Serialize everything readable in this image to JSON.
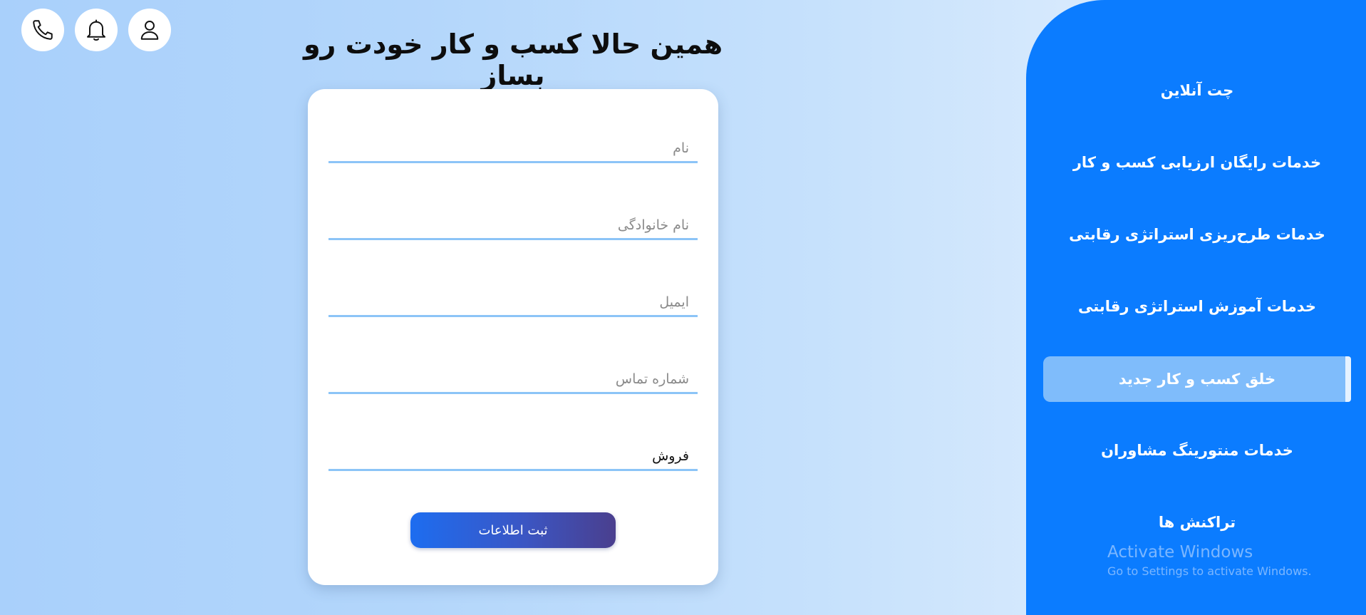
{
  "header": {
    "title": "همین حالا کسب و کار خودت رو بساز",
    "icons": [
      "phone-icon",
      "bell-icon",
      "user-icon"
    ]
  },
  "form": {
    "fields": [
      {
        "placeholder": "نام",
        "value": ""
      },
      {
        "placeholder": "نام خانوادگی",
        "value": ""
      },
      {
        "placeholder": "ایمیل",
        "value": ""
      },
      {
        "placeholder": "شماره تماس",
        "value": ""
      },
      {
        "placeholder": "",
        "value": "فروش"
      }
    ],
    "submit_label": "ثبت اطلاعات"
  },
  "sidebar": {
    "items": [
      {
        "label": "چت آنلاین",
        "active": false
      },
      {
        "label": "خدمات رایگان ارزیابی کسب و کار",
        "active": false
      },
      {
        "label": "خدمات طرح‌ریزی استراتژی رقابتی",
        "active": false
      },
      {
        "label": "خدمات آموزش استراتژی رقابتی",
        "active": false
      },
      {
        "label": "خلق کسب و کار جدید",
        "active": true
      },
      {
        "label": "خدمات منتورینگ مشاوران",
        "active": false
      },
      {
        "label": "تراکنش ها",
        "active": false
      }
    ]
  },
  "watermark": {
    "title": "Activate Windows",
    "subtitle": "Go to Settings to activate Windows."
  },
  "colors": {
    "sidebar_bg": "#0b7cff",
    "active_item_bg": "#7fbcfb",
    "field_underline": "#8cc4f7",
    "button_gradient_start": "#1d6df0",
    "button_gradient_end": "#4a3f8e"
  }
}
